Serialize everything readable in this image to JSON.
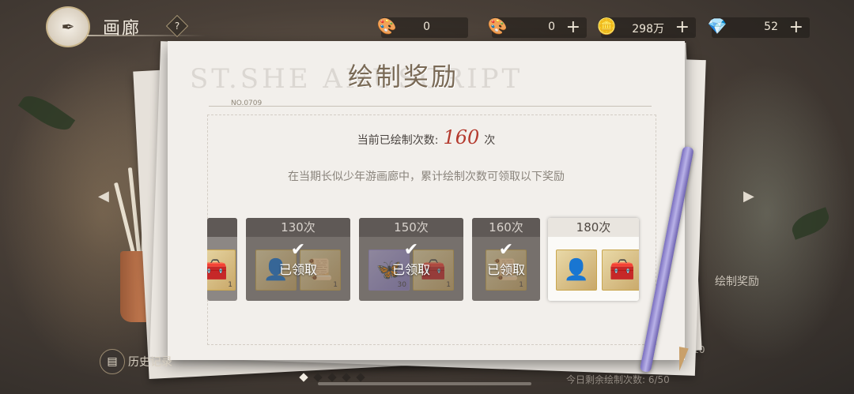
{
  "header": {
    "logo_icon": "quill-badge-icon",
    "title": "画廊",
    "help_icon": "?"
  },
  "currencies": [
    {
      "icon": "paint-set-icon",
      "value": "0",
      "plus": ""
    },
    {
      "icon": "paint-set-icon",
      "value": "0",
      "plus": "+"
    },
    {
      "icon": "coin-icon",
      "value": "298万",
      "plus": "+"
    },
    {
      "icon": "diamond-icon",
      "value": "52",
      "plus": "+"
    }
  ],
  "panel": {
    "watermark": "ST.SHE          ANUSCRIPT",
    "title": "绘制奖励",
    "doc_no": "NO.0709",
    "count_prefix": "当前已绘制次数:",
    "count_value": "160",
    "count_suffix": "次",
    "description": "在当期长似少年游画廊中，累计绘制次数可领取以下奖励"
  },
  "rewards": [
    {
      "label": "",
      "claimed": false,
      "items": [
        {
          "icon": "jewelry-box-icon",
          "qty": "1"
        }
      ]
    },
    {
      "label": "130次",
      "claimed": true,
      "claimed_text": "已领取",
      "items": [
        {
          "icon": "avatar-frame-icon",
          "qty": ""
        },
        {
          "icon": "scroll-item-icon",
          "qty": "1"
        }
      ]
    },
    {
      "label": "150次",
      "claimed": true,
      "claimed_text": "已领取",
      "items": [
        {
          "icon": "butterfly-icon",
          "qty": "30"
        },
        {
          "icon": "jewelry-box-icon",
          "qty": "1"
        }
      ]
    },
    {
      "label": "160次",
      "claimed": true,
      "claimed_text": "已领取",
      "items": [
        {
          "icon": "scroll-item-icon",
          "qty": "1"
        }
      ]
    },
    {
      "label": "180次",
      "claimed": false,
      "items": [
        {
          "icon": "avatar-frame-icon",
          "qty": ""
        },
        {
          "icon": "jewelry-box-icon",
          "qty": ""
        }
      ]
    }
  ],
  "background": {
    "history_label": "历史记录",
    "right_label": "绘制奖励",
    "draw_x10": "X10",
    "remaining_text": "今日剩余绘制次数: 6/50"
  },
  "pagination": {
    "total": 5,
    "current": 0
  }
}
